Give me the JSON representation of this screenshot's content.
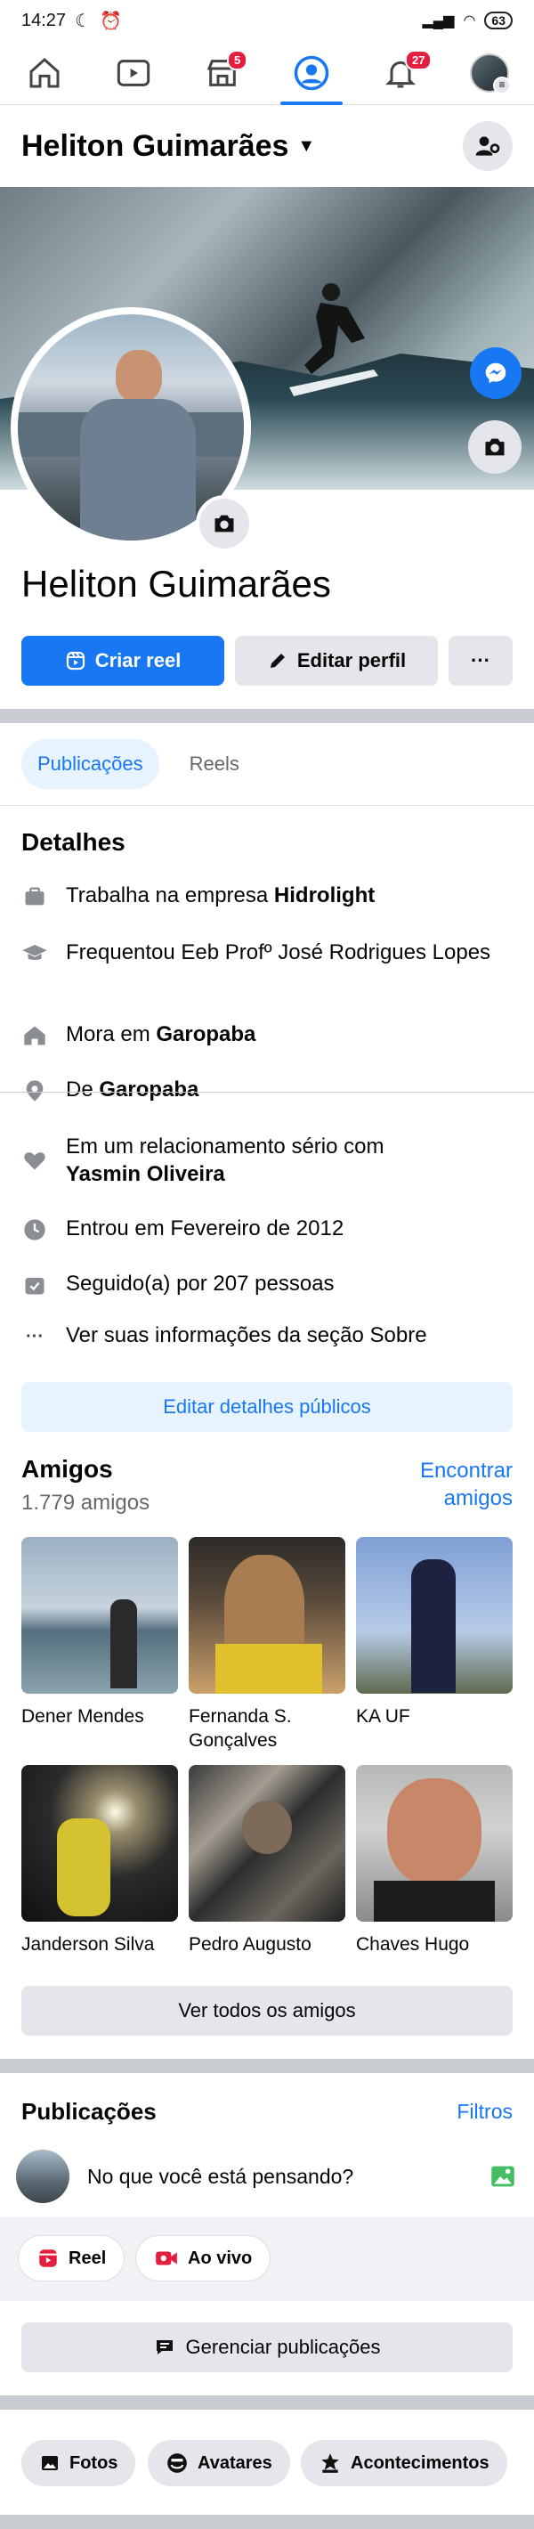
{
  "status_bar": {
    "time": "14:27",
    "battery": "63"
  },
  "nav": {
    "market_badge": "5",
    "notif_badge": "27"
  },
  "header": {
    "name": "Heliton Guimarães"
  },
  "profile": {
    "name": "Heliton Guimarães",
    "create_reel": "Criar reel",
    "edit_profile": "Editar perfil",
    "more": "···"
  },
  "tabs": [
    "Publicações",
    "Reels"
  ],
  "details": {
    "title": "Detalhes",
    "work_prefix": "Trabalha na empresa ",
    "work_company": "Hidrolight",
    "education": "Frequentou Eeb Profº José Rodrigues Lopes",
    "lives_prefix": "Mora em ",
    "lives_city": "Garopaba",
    "from_prefix": "De ",
    "from_city": "Garopaba",
    "relationship_prefix": "Em um relacionamento sério com",
    "relationship_person": "Yasmin Oliveira",
    "joined": "Entrou em Fevereiro de 2012",
    "followers": "Seguido(a) por 207 pessoas",
    "see_about": "Ver suas informações da seção Sobre",
    "edit_button": "Editar detalhes públicos"
  },
  "friends": {
    "title": "Amigos",
    "count": "1.779 amigos",
    "find_line1": "Encontrar",
    "find_line2": "amigos",
    "list": [
      {
        "name": "Dener Mendes"
      },
      {
        "name": "Fernanda S. Gonçalves"
      },
      {
        "name": "KA UF"
      },
      {
        "name": "Janderson Silva"
      },
      {
        "name": "Pedro Augusto"
      },
      {
        "name": "Chaves Hugo"
      }
    ],
    "see_all": "Ver todos os amigos"
  },
  "posts": {
    "title": "Publicações",
    "filters": "Filtros",
    "composer": "No que você está pensando?",
    "reel": "Reel",
    "live": "Ao vivo",
    "manage": "Gerenciar publicações"
  },
  "bottom_pills": {
    "photos": "Fotos",
    "avatars": "Avatares",
    "events": "Acontecimentos"
  },
  "colors": {
    "accent": "#1877f2",
    "badge": "#e41e3f",
    "gray_button": "#e4e6eb"
  }
}
